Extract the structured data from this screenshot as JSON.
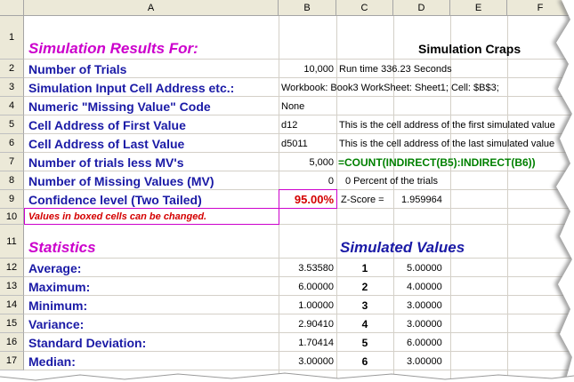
{
  "columns": [
    "A",
    "B",
    "C",
    "D",
    "E",
    "F"
  ],
  "rows": [
    "1",
    "2",
    "3",
    "4",
    "5",
    "6",
    "7",
    "8",
    "9",
    "10",
    "11",
    "12",
    "13",
    "14",
    "15",
    "16",
    "17"
  ],
  "col_a": {
    "r1": "Simulation Results For:",
    "r2": "Number of Trials",
    "r3": "Simulation Input Cell Address etc.:",
    "r4": "Numeric \"Missing Value\" Code",
    "r5": "Cell Address of First Value",
    "r6": "Cell Address of Last Value",
    "r7": "Number of trials less MV's",
    "r8": "Number of Missing Values (MV)",
    "r9": "Confidence level (Two Tailed)",
    "r10": "Values in boxed cells can be changed.",
    "r11": "Statistics",
    "r12": "Average:",
    "r13": "Maximum:",
    "r14": "Minimum:",
    "r15": "Variance:",
    "r16": "Standard Deviation:",
    "r17": "Median:"
  },
  "col_b": {
    "r2": "10,000",
    "r3": "Workbook:  Book3  WorkSheet: Sheet1;  Cell: $B$3;",
    "r4": "None",
    "r5": "d12",
    "r6": "d5011",
    "r7": "5,000",
    "r8": "0",
    "r9": "95.00%",
    "r12": "3.53580",
    "r13": "6.00000",
    "r14": "1.00000",
    "r15": "2.90410",
    "r16": "1.70414",
    "r17": "3.00000"
  },
  "col_c": {
    "r1": "Simulation  Craps",
    "r2": "Run time 336.23 Seconds",
    "r5": "This is the cell address of the first simulated value",
    "r6": "This is the cell address of the last simulated value",
    "r7": "=COUNT(INDIRECT(B5):INDIRECT(B6))",
    "r8": "0 Percent of the trials",
    "r9_label": "Z-Score =",
    "r9_value": "1.959964",
    "r11": "Simulated Values"
  },
  "simulated": {
    "index": [
      "1",
      "2",
      "3",
      "4",
      "5",
      "6"
    ],
    "values": [
      "5.00000",
      "4.00000",
      "3.00000",
      "3.00000",
      "6.00000",
      "3.00000"
    ]
  }
}
